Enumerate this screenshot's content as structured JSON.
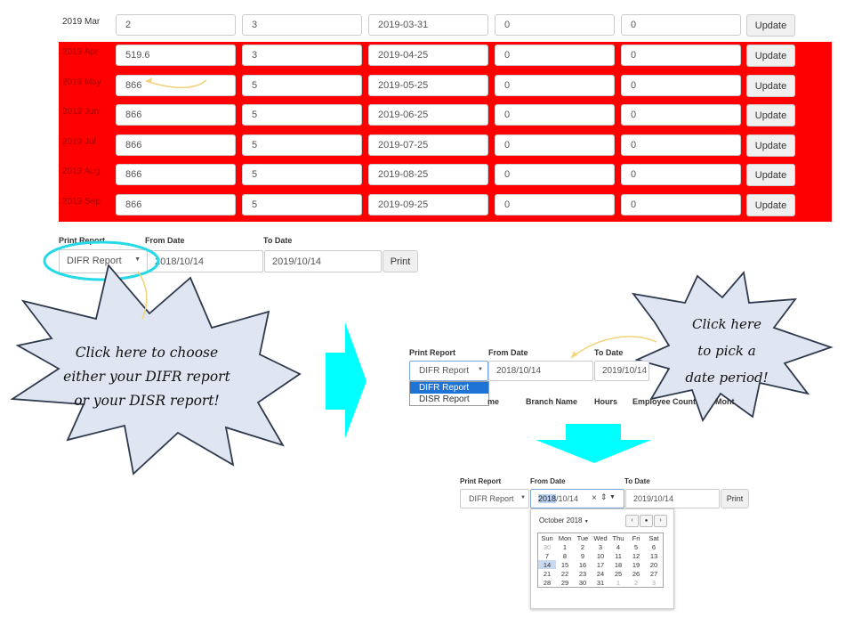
{
  "table": {
    "rows": [
      {
        "label": "2019 Mar",
        "a": "2",
        "b": "3",
        "date": "2019-03-31",
        "c": "0",
        "d": "0",
        "button": "Update"
      },
      {
        "label": "2019 Apr",
        "a": "519.6",
        "b": "3",
        "date": "2019-04-25",
        "c": "0",
        "d": "0",
        "button": "Update"
      },
      {
        "label": "2019 May",
        "a": "866",
        "b": "5",
        "date": "2019-05-25",
        "c": "0",
        "d": "0",
        "button": "Update"
      },
      {
        "label": "2019 Jun",
        "a": "866",
        "b": "5",
        "date": "2019-06-25",
        "c": "0",
        "d": "0",
        "button": "Update"
      },
      {
        "label": "2019 Jul",
        "a": "866",
        "b": "5",
        "date": "2019-07-25",
        "c": "0",
        "d": "0",
        "button": "Update"
      },
      {
        "label": "2019 Aug",
        "a": "866",
        "b": "5",
        "date": "2019-08-25",
        "c": "0",
        "d": "0",
        "button": "Update"
      },
      {
        "label": "2019 Sep",
        "a": "866",
        "b": "5",
        "date": "2019-09-25",
        "c": "0",
        "d": "0",
        "button": "Update"
      }
    ],
    "highlight_color": "#ff0000"
  },
  "report": {
    "print_report_label": "Print Report",
    "from_date_label": "From Date",
    "to_date_label": "To Date",
    "selected_report": "DIFR Report",
    "from_date": "2018/10/14",
    "to_date": "2019/10/14",
    "print_button": "Print"
  },
  "callouts": {
    "left_lines": [
      "Click here to choose",
      "either your DIFR report",
      "or your DISR report!"
    ],
    "right_lines": [
      "Click here",
      "to pick a",
      "date period!"
    ]
  },
  "middle": {
    "print_report_label": "Print Report",
    "from_date_label": "From Date",
    "to_date_label": "To Date",
    "selected_report": "DIFR Report",
    "from_date": "2018/10/14",
    "to_date": "2019/10/14",
    "options": [
      "DIFR Report",
      "DISR Report"
    ],
    "columns": [
      "me",
      "Branch Name",
      "Hours",
      "Employee Count",
      "Mont"
    ]
  },
  "bottom": {
    "print_report_label": "Print Report",
    "from_date_label": "From Date",
    "to_date_label": "To Date",
    "selected_report": "DIFR Report",
    "from_date_year": "2018",
    "from_date_rest": "/10/14",
    "to_date": "2019/10/14",
    "print_button": "Print",
    "calendar": {
      "month": "October 2018",
      "weekdays": [
        "Sun",
        "Mon",
        "Tue",
        "Wed",
        "Thu",
        "Fri",
        "Sat"
      ],
      "weeks": [
        [
          "30",
          "1",
          "2",
          "3",
          "4",
          "5",
          "6"
        ],
        [
          "7",
          "8",
          "9",
          "10",
          "11",
          "12",
          "13"
        ],
        [
          "14",
          "15",
          "16",
          "17",
          "18",
          "19",
          "20"
        ],
        [
          "21",
          "22",
          "23",
          "24",
          "25",
          "26",
          "27"
        ],
        [
          "28",
          "29",
          "30",
          "31",
          "1",
          "2",
          "3"
        ]
      ],
      "selected": "14"
    }
  },
  "colors": {
    "arrow": "#00ffff",
    "callout_fill": "#dfe6f2",
    "callout_stroke": "#2f3a4d",
    "highlight_ring": "#25d9e6"
  }
}
